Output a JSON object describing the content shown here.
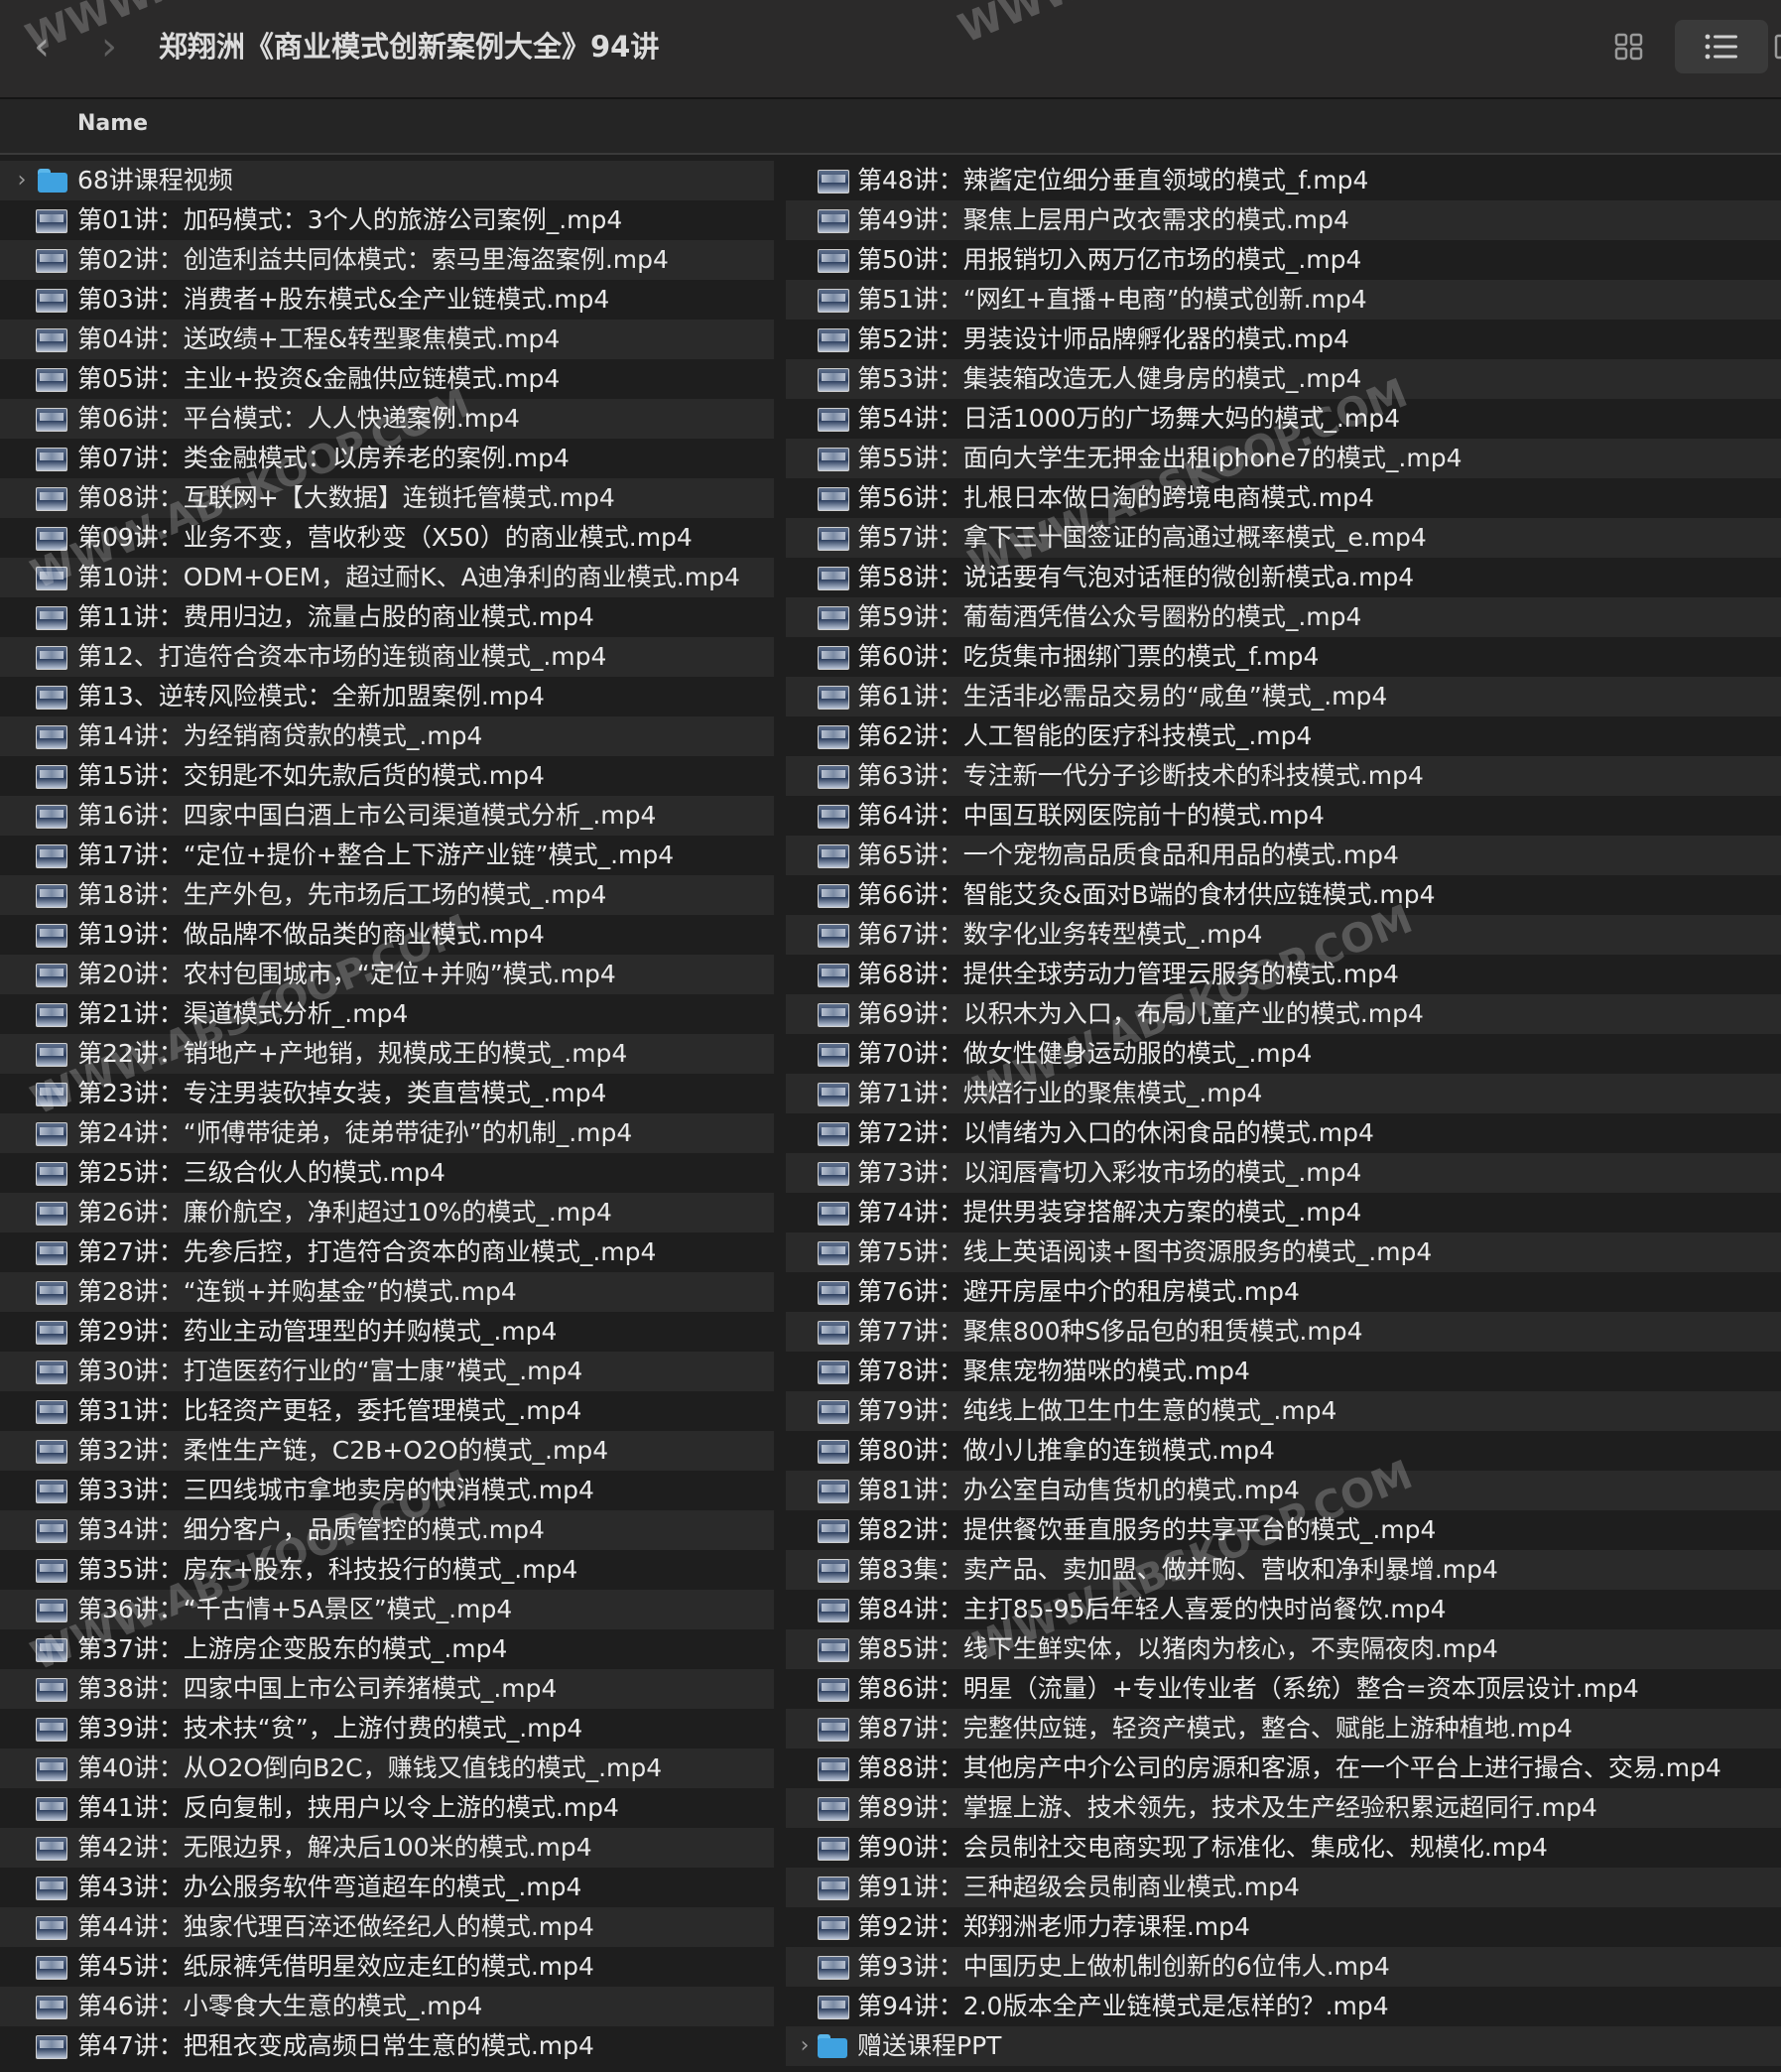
{
  "window": {
    "title": "郑翔洲《商业模式创新案例大全》94讲"
  },
  "toolbar": {
    "back_icon": "chevron-left-icon",
    "forward_icon": "chevron-right-icon",
    "grid_view_icon": "grid-view-icon",
    "list_view_icon": "list-view-icon"
  },
  "header": {
    "name_column": "Name"
  },
  "left_column": [
    {
      "label": "68讲课程视频",
      "kind": "folder"
    },
    {
      "label": "第01讲：加码模式：3个人的旅游公司案例_.mp4",
      "kind": "video"
    },
    {
      "label": "第02讲：创造利益共同体模式：索马里海盗案例.mp4",
      "kind": "video"
    },
    {
      "label": "第03讲：消费者+股东模式&全产业链模式.mp4",
      "kind": "video"
    },
    {
      "label": "第04讲：送政绩+工程&转型聚焦模式.mp4",
      "kind": "video"
    },
    {
      "label": "第05讲：主业+投资&金融供应链模式.mp4",
      "kind": "video"
    },
    {
      "label": "第06讲：平台模式：人人快递案例.mp4",
      "kind": "video"
    },
    {
      "label": "第07讲：类金融模式：以房养老的案例.mp4",
      "kind": "video"
    },
    {
      "label": "第08讲：互联网+【大数据】连锁托管模式.mp4",
      "kind": "video"
    },
    {
      "label": "第09讲：业务不变，营收秒变（X50）的商业模式.mp4",
      "kind": "video"
    },
    {
      "label": "第10讲：ODM+OEM，超过耐K、A迪净利的商业模式.mp4",
      "kind": "video"
    },
    {
      "label": "第11讲：费用归边，流量占股的商业模式.mp4",
      "kind": "video"
    },
    {
      "label": "第12、打造符合资本市场的连锁商业模式_.mp4",
      "kind": "video"
    },
    {
      "label": "第13、逆转风险模式：全新加盟案例.mp4",
      "kind": "video"
    },
    {
      "label": "第14讲：为经销商贷款的模式_.mp4",
      "kind": "video"
    },
    {
      "label": "第15讲：交钥匙不如先款后货的模式.mp4",
      "kind": "video"
    },
    {
      "label": "第16讲：四家中国白酒上市公司渠道模式分析_.mp4",
      "kind": "video"
    },
    {
      "label": "第17讲：“定位+提价+整合上下游产业链”模式_.mp4",
      "kind": "video"
    },
    {
      "label": "第18讲：生产外包，先市场后工场的模式_.mp4",
      "kind": "video"
    },
    {
      "label": "第19讲：做品牌不做品类的商业模式.mp4",
      "kind": "video"
    },
    {
      "label": "第20讲：农村包围城市，“定位+并购”模式.mp4",
      "kind": "video"
    },
    {
      "label": "第21讲：渠道模式分析_.mp4",
      "kind": "video"
    },
    {
      "label": "第22讲：销地产+产地销，规模成王的模式_.mp4",
      "kind": "video"
    },
    {
      "label": "第23讲：专注男装砍掉女装，类直营模式_.mp4",
      "kind": "video"
    },
    {
      "label": "第24讲：“师傅带徒弟，徒弟带徒孙”的机制_.mp4",
      "kind": "video"
    },
    {
      "label": "第25讲：三级合伙人的模式.mp4",
      "kind": "video"
    },
    {
      "label": "第26讲：廉价航空，净利超过10%的模式_.mp4",
      "kind": "video"
    },
    {
      "label": "第27讲：先参后控，打造符合资本的商业模式_.mp4",
      "kind": "video"
    },
    {
      "label": "第28讲：“连锁+并购基金”的模式.mp4",
      "kind": "video"
    },
    {
      "label": "第29讲：药业主动管理型的并购模式_.mp4",
      "kind": "video"
    },
    {
      "label": "第30讲：打造医药行业的“富士康”模式_.mp4",
      "kind": "video"
    },
    {
      "label": "第31讲：比轻资产更轻，委托管理模式_.mp4",
      "kind": "video"
    },
    {
      "label": "第32讲：柔性生产链，C2B+O2O的模式_.mp4",
      "kind": "video"
    },
    {
      "label": "第33讲：三四线城市拿地卖房的快消模式.mp4",
      "kind": "video"
    },
    {
      "label": "第34讲：细分客户，品质管控的模式.mp4",
      "kind": "video"
    },
    {
      "label": "第35讲：房东+股东，科技投行的模式_.mp4",
      "kind": "video"
    },
    {
      "label": "第36讲：“千古情+5A景区”模式_.mp4",
      "kind": "video"
    },
    {
      "label": "第37讲：上游房企变股东的模式_.mp4",
      "kind": "video"
    },
    {
      "label": "第38讲：四家中国上市公司养猪模式_.mp4",
      "kind": "video"
    },
    {
      "label": "第39讲：技术扶“贫”，上游付费的模式_.mp4",
      "kind": "video"
    },
    {
      "label": "第40讲：从O2O倒向B2C，赚钱又值钱的模式_.mp4",
      "kind": "video"
    },
    {
      "label": "第41讲：反向复制，挟用户以令上游的模式.mp4",
      "kind": "video"
    },
    {
      "label": "第42讲：无限边界，解决后100米的模式.mp4",
      "kind": "video"
    },
    {
      "label": "第43讲：办公服务软件弯道超车的模式_.mp4",
      "kind": "video"
    },
    {
      "label": "第44讲：独家代理百淬还做经纪人的模式.mp4",
      "kind": "video"
    },
    {
      "label": "第45讲：纸尿裤凭借明星效应走红的模式.mp4",
      "kind": "video"
    },
    {
      "label": "第46讲：小零食大生意的模式_.mp4",
      "kind": "video"
    },
    {
      "label": "第47讲：把租衣变成高频日常生意的模式.mp4",
      "kind": "video"
    }
  ],
  "right_column": [
    {
      "label": "第48讲：辣酱定位细分垂直领域的模式_f.mp4",
      "kind": "video"
    },
    {
      "label": "第49讲：聚焦上层用户改衣需求的模式.mp4",
      "kind": "video"
    },
    {
      "label": "第50讲：用报销切入两万亿市场的模式_.mp4",
      "kind": "video"
    },
    {
      "label": "第51讲：“网红+直播+电商”的模式创新.mp4",
      "kind": "video"
    },
    {
      "label": "第52讲：男装设计师品牌孵化器的模式.mp4",
      "kind": "video"
    },
    {
      "label": "第53讲：集装箱改造无人健身房的模式_.mp4",
      "kind": "video"
    },
    {
      "label": "第54讲：日活1000万的广场舞大妈的模式_.mp4",
      "kind": "video"
    },
    {
      "label": "第55讲：面向大学生无押金出租iphone7的模式_.mp4",
      "kind": "video"
    },
    {
      "label": "第56讲：扎根日本做日淘的跨境电商模式.mp4",
      "kind": "video"
    },
    {
      "label": "第57讲：拿下三十国签证的高通过概率模式_e.mp4",
      "kind": "video"
    },
    {
      "label": "第58讲：说话要有气泡对话框的微创新模式a.mp4",
      "kind": "video"
    },
    {
      "label": "第59讲：葡萄酒凭借公众号圈粉的模式_.mp4",
      "kind": "video"
    },
    {
      "label": "第60讲：吃货集市捆绑门票的模式_f.mp4",
      "kind": "video"
    },
    {
      "label": "第61讲：生活非必需品交易的“咸鱼”模式_.mp4",
      "kind": "video"
    },
    {
      "label": "第62讲：人工智能的医疗科技模式_.mp4",
      "kind": "video"
    },
    {
      "label": "第63讲：专注新一代分子诊断技术的科技模式.mp4",
      "kind": "video"
    },
    {
      "label": "第64讲：中国互联网医院前十的模式.mp4",
      "kind": "video"
    },
    {
      "label": "第65讲：一个宠物高品质食品和用品的模式.mp4",
      "kind": "video"
    },
    {
      "label": "第66讲：智能艾灸&面对B端的食材供应链模式.mp4",
      "kind": "video"
    },
    {
      "label": "第67讲：数字化业务转型模式_.mp4",
      "kind": "video"
    },
    {
      "label": "第68讲：提供全球劳动力管理云服务的模式.mp4",
      "kind": "video"
    },
    {
      "label": "第69讲：以积木为入口，布局儿童产业的模式.mp4",
      "kind": "video"
    },
    {
      "label": "第70讲：做女性健身运动服的模式_.mp4",
      "kind": "video"
    },
    {
      "label": "第71讲：烘焙行业的聚焦模式_.mp4",
      "kind": "video"
    },
    {
      "label": "第72讲：以情绪为入口的休闲食品的模式.mp4",
      "kind": "video"
    },
    {
      "label": "第73讲：以润唇膏切入彩妆市场的模式_.mp4",
      "kind": "video"
    },
    {
      "label": "第74讲：提供男装穿搭解决方案的模式_.mp4",
      "kind": "video"
    },
    {
      "label": "第75讲：线上英语阅读+图书资源服务的模式_.mp4",
      "kind": "video"
    },
    {
      "label": "第76讲：避开房屋中介的租房模式.mp4",
      "kind": "video"
    },
    {
      "label": "第77讲：聚焦800种S侈品包的租赁模式.mp4",
      "kind": "video"
    },
    {
      "label": "第78讲：聚焦宠物猫咪的模式.mp4",
      "kind": "video"
    },
    {
      "label": "第79讲：纯线上做卫生巾生意的模式_.mp4",
      "kind": "video"
    },
    {
      "label": "第80讲：做小儿推拿的连锁模式.mp4",
      "kind": "video"
    },
    {
      "label": "第81讲：办公室自动售货机的模式.mp4",
      "kind": "video"
    },
    {
      "label": "第82讲：提供餐饮垂直服务的共享平台的模式_.mp4",
      "kind": "video"
    },
    {
      "label": "第83集：卖产品、卖加盟、做并购、营收和净利暴增.mp4",
      "kind": "video"
    },
    {
      "label": "第84讲：主打85-95后年轻人喜爱的快时尚餐饮.mp4",
      "kind": "video"
    },
    {
      "label": "第85讲：线下生鲜实体，以猪肉为核心，不卖隔夜肉.mp4",
      "kind": "video"
    },
    {
      "label": "第86讲：明星（流量）+专业传业者（系统）整合=资本顶层设计.mp4",
      "kind": "video"
    },
    {
      "label": "第87讲：完整供应链，轻资产模式，整合、赋能上游种植地.mp4",
      "kind": "video"
    },
    {
      "label": "第88讲：其他房产中介公司的房源和客源，在一个平台上进行撮合、交易.mp4",
      "kind": "video"
    },
    {
      "label": "第89讲：掌握上游、技术领先，技术及生产经验积累远超同行.mp4",
      "kind": "video"
    },
    {
      "label": "第90讲：会员制社交电商实现了标准化、集成化、规模化.mp4",
      "kind": "video"
    },
    {
      "label": "第91讲：三种超级会员制商业模式.mp4",
      "kind": "video"
    },
    {
      "label": "第92讲：郑翔洲老师力荐课程.mp4",
      "kind": "video"
    },
    {
      "label": "第93讲：中国历史上做机制创新的6位伟人.mp4",
      "kind": "video"
    },
    {
      "label": "第94讲：2.0版本全产业链模式是怎样的？.mp4",
      "kind": "video"
    },
    {
      "label": "赠送课程PPT",
      "kind": "folder"
    }
  ],
  "watermark": {
    "text": "WWW.ABSKOOP.COM"
  }
}
